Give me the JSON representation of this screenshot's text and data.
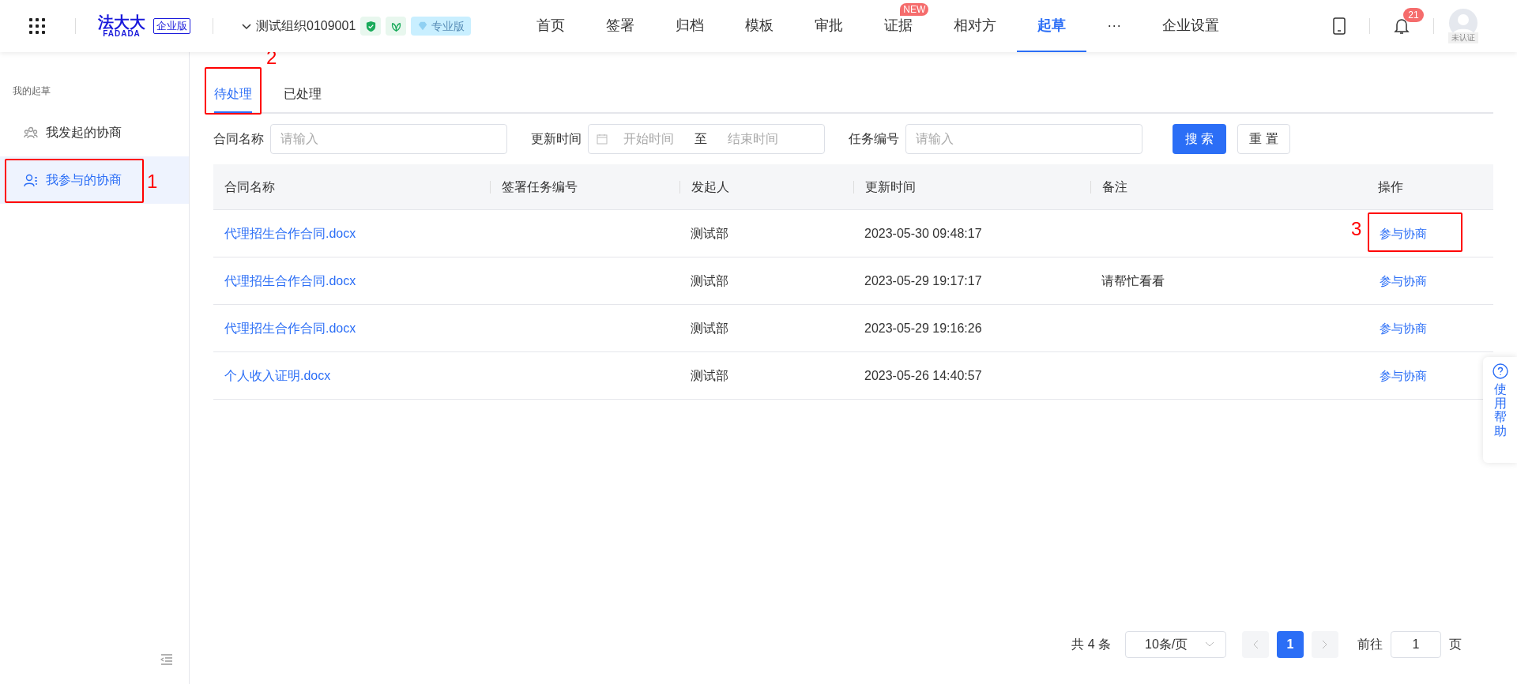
{
  "topbar": {
    "logo": {
      "name": "法大大",
      "sub": "FADADA",
      "edition": "企业版"
    },
    "org": {
      "name": "测试组织0109001",
      "plan": "专业版"
    },
    "nav": [
      {
        "label": "首页",
        "selected": false
      },
      {
        "label": "签署",
        "selected": false
      },
      {
        "label": "归档",
        "selected": false
      },
      {
        "label": "模板",
        "selected": false
      },
      {
        "label": "审批",
        "selected": false
      },
      {
        "label": "证据",
        "selected": false,
        "badge": "NEW"
      },
      {
        "label": "相对方",
        "selected": false
      },
      {
        "label": "起草",
        "selected": true
      },
      {
        "label": "···",
        "selected": false
      },
      {
        "label": "企业设置",
        "selected": false
      }
    ],
    "notifications": "21",
    "account_status": "未认证"
  },
  "sidebar": {
    "heading": "我的起草",
    "items": [
      {
        "label": "我发起的协商",
        "selected": false
      },
      {
        "label": "我参与的协商",
        "selected": true,
        "annotation": "1"
      }
    ]
  },
  "tabs": [
    {
      "label": "待处理",
      "selected": true,
      "annotation": "2"
    },
    {
      "label": "已处理",
      "selected": false
    }
  ],
  "filters": {
    "contract_label": "合同名称",
    "contract_placeholder": "请输入",
    "time_label": "更新时间",
    "start_placeholder": "开始时间",
    "to": "至",
    "end_placeholder": "结束时间",
    "task_label": "任务编号",
    "task_placeholder": "请输入",
    "search": "搜 索",
    "reset": "重 置"
  },
  "table": {
    "columns": [
      "合同名称",
      "签署任务编号",
      "发起人",
      "更新时间",
      "备注",
      "操作"
    ],
    "rows": [
      {
        "name": "代理招生合作合同.docx",
        "initiator": "测试部",
        "updated": "2023-05-30 09:48:17",
        "action": "参与协商",
        "annotation": "3"
      },
      {
        "name": "代理招生合作合同.docx",
        "initiator": "测试部",
        "updated": "2023-05-29 19:17:17",
        "note": "请帮忙看看",
        "action": "参与协商"
      },
      {
        "name": "代理招生合作合同.docx",
        "initiator": "测试部",
        "updated": "2023-05-29 19:16:26",
        "action": "参与协商"
      },
      {
        "name": "个人收入证明.docx",
        "initiator": "测试部",
        "updated": "2023-05-26 14:40:57",
        "action": "参与协商"
      }
    ]
  },
  "pagination": {
    "total": "共 4 条",
    "page_size": "10条/页",
    "pages": [
      {
        "label": "1",
        "selected": true
      }
    ],
    "goto_label": "前往",
    "goto_value": "1",
    "goto_unit": "页"
  },
  "help": "使用帮助"
}
